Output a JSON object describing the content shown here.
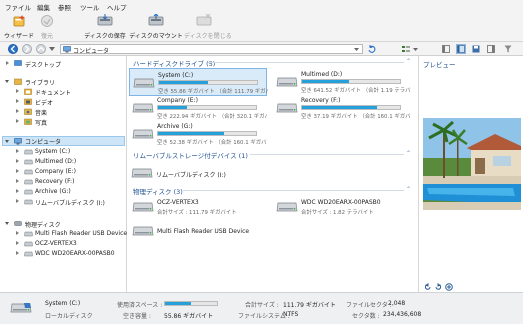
{
  "menu": [
    "ファイル",
    "編集",
    "参照",
    "ツール",
    "ヘルプ"
  ],
  "toolbar": {
    "wizard": "ウィザード",
    "recover": "復元",
    "save_disk": "ディスクの保存",
    "mount_disk": "ディスクのマウント",
    "close_disk": "ディスクを閉じる"
  },
  "address": {
    "path": "コンピュータ"
  },
  "tree": {
    "desktop": "デスクトップ",
    "libraries": "ライブラリ",
    "documents": "ドキュメント",
    "videos": "ビデオ",
    "music": "音楽",
    "pictures": "写真",
    "computer": "コンピュータ",
    "drives": [
      "System (C:)",
      "Multimed (D:)",
      "Company (E:)",
      "Recovery (F:)",
      "Archive (G:)",
      "リムーバブルディスク (I:)"
    ],
    "physical": "物理ディスク",
    "physical_items": [
      "Multi Flash Reader USB Device",
      "OCZ-VERTEX3",
      "WDC WD20EARX-00PASB0"
    ]
  },
  "sections": {
    "hdd": "ハードディスクドライブ (5)",
    "removable": "リムーバブルストレージ付デバイス (1)",
    "physical": "物理ディスク (3)"
  },
  "drives": [
    {
      "name": "System (C:)",
      "info": "空き 55.86 ギガバイト （合計 111.79 ギガバイト）",
      "used_pct": 50,
      "selected": true
    },
    {
      "name": "Multimed (D:)",
      "info": "空き 641.52 ギガバイト （合計 1.19 テラバイト）",
      "used_pct": 48,
      "selected": false
    },
    {
      "name": "Company (E:)",
      "info": "空き 222.94 ギガバイト （合計 320.1 ギガバイト）",
      "used_pct": 30,
      "selected": false
    },
    {
      "name": "Recovery (F:)",
      "info": "空き 37.19 ギガバイト （合計 160.1 ギガバイト）",
      "used_pct": 77,
      "selected": false
    },
    {
      "name": "Archive (G:)",
      "info": "空き 52.38 ギガバイト （合計 160.1 ギガバイト）",
      "used_pct": 67,
      "selected": false
    }
  ],
  "removable": {
    "name": "リムーバブルディスク (I:)"
  },
  "physical": [
    {
      "name": "OCZ-VERTEX3",
      "info": "合計サイズ : 111.79 ギガバイト"
    },
    {
      "name": "WDC WD20EARX-00PASB0",
      "info": "合計サイズ : 1.82 テラバイト"
    },
    {
      "name": "Multi Flash Reader USB Device",
      "info": ""
    }
  ],
  "preview": {
    "title": "プレビュー"
  },
  "status": {
    "drive_name": "System (C:)",
    "drive_type": "ローカルディスク",
    "used_label": "使用済スペース :",
    "free_label": "空き容量 :",
    "free_value": "55.86 ギガバイト",
    "used_pct": 50,
    "total_label": "合計サイズ :",
    "total_value": "111.79 ギガバイト",
    "fs_label": "ファイルシステム :",
    "fs_value": "NTFS",
    "cluster_label": "ファイルセクタ :",
    "cluster_value": "2,048",
    "sectors_label": "セクタ数 :",
    "sectors_value": "234,436,608"
  },
  "colors": {
    "accent": "#26a0da",
    "selection": "#cde5f7",
    "section_title": "#1e4f91"
  }
}
